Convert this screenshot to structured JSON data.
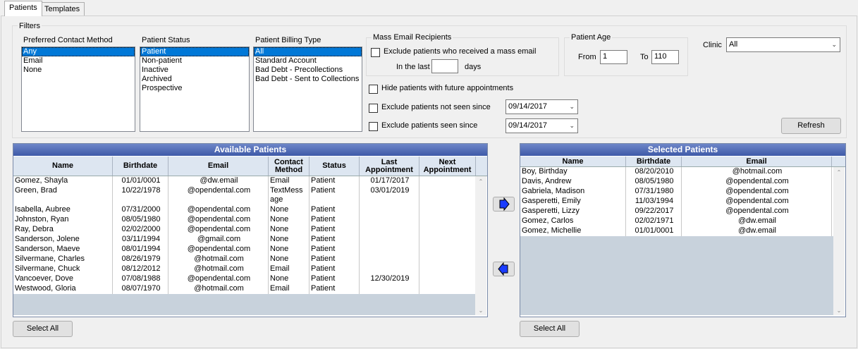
{
  "tabs": [
    {
      "label": "Patients"
    },
    {
      "label": "Templates"
    }
  ],
  "filters": {
    "group_label": "Filters",
    "preferred_contact": {
      "label": "Preferred Contact Method",
      "options": [
        "Any",
        "Email",
        "None"
      ],
      "selected": 0
    },
    "patient_status": {
      "label": "Patient Status",
      "options": [
        "Patient",
        "Non-patient",
        "Inactive",
        "Archived",
        "Prospective"
      ],
      "selected": 0
    },
    "billing_type": {
      "label": "Patient Billing Type",
      "options": [
        "All",
        "Standard Account",
        "Bad Debt - Precollections",
        "Bad Debt - Sent to Collections"
      ],
      "selected": 0
    },
    "mass_email": {
      "group_label": "Mass Email Recipients",
      "exclude_label": "Exclude patients who received a mass email",
      "in_last_label": "In the last",
      "in_last_value": "",
      "days_label": "days"
    },
    "hide_future_label": "Hide patients with future appointments",
    "exclude_not_seen": {
      "label": "Exclude patients not seen since",
      "date": "09/14/2017"
    },
    "exclude_seen": {
      "label": "Exclude patients seen since",
      "date": "09/14/2017"
    },
    "age": {
      "group_label": "Patient Age",
      "from_label": "From",
      "from_value": "1",
      "to_label": "To",
      "to_value": "110"
    },
    "clinic": {
      "label": "Clinic",
      "value": "All"
    },
    "refresh_label": "Refresh"
  },
  "available": {
    "title": "Available Patients",
    "headers": [
      "Name",
      "Birthdate",
      "Email",
      "Contact Method",
      "Status",
      "Last Appointment",
      "Next Appointment"
    ],
    "rows": [
      {
        "name": "Gomez, Shayla",
        "birth": "01/01/0001",
        "email": "@dw.email",
        "contact": "Email",
        "status": "Patient",
        "last": "01/17/2017",
        "next": ""
      },
      {
        "name": "Green, Brad",
        "birth": "10/22/1978",
        "email": "@opendental.com",
        "contact": "TextMess age",
        "status": "Patient",
        "last": "03/01/2019",
        "next": ""
      },
      {
        "name": "Isabella, Aubree",
        "birth": "07/31/2000",
        "email": "@opendental.com",
        "contact": "None",
        "status": "Patient",
        "last": "",
        "next": ""
      },
      {
        "name": "Johnston, Ryan",
        "birth": "08/05/1980",
        "email": "@opendental.com",
        "contact": "None",
        "status": "Patient",
        "last": "",
        "next": ""
      },
      {
        "name": "Ray, Debra",
        "birth": "02/02/2000",
        "email": "@opendental.com",
        "contact": "None",
        "status": "Patient",
        "last": "",
        "next": ""
      },
      {
        "name": "Sanderson, Jolene",
        "birth": "03/11/1994",
        "email": "@gmail.com",
        "contact": "None",
        "status": "Patient",
        "last": "",
        "next": ""
      },
      {
        "name": "Sanderson, Maeve",
        "birth": "08/01/1994",
        "email": "@opendental.com",
        "contact": "None",
        "status": "Patient",
        "last": "",
        "next": ""
      },
      {
        "name": "Silvermane, Charles",
        "birth": "08/26/1979",
        "email": "@hotmail.com",
        "contact": "None",
        "status": "Patient",
        "last": "",
        "next": ""
      },
      {
        "name": "Silvermane, Chuck",
        "birth": "08/12/2012",
        "email": "@hotmail.com",
        "contact": "Email",
        "status": "Patient",
        "last": "",
        "next": ""
      },
      {
        "name": "Vancoever, Dove",
        "birth": "07/08/1988",
        "email": "@opendental.com",
        "contact": "None",
        "status": "Patient",
        "last": "12/30/2019",
        "next": ""
      },
      {
        "name": "Westwood, Gloria",
        "birth": "08/07/1970",
        "email": "@hotmail.com",
        "contact": "Email",
        "status": "Patient",
        "last": "",
        "next": ""
      }
    ],
    "select_all_label": "Select All"
  },
  "selected": {
    "title": "Selected Patients",
    "headers": [
      "Name",
      "Birthdate",
      "Email"
    ],
    "rows": [
      {
        "name": "Boy, Birthday",
        "birth": "08/20/2010",
        "email": "@hotmail.com"
      },
      {
        "name": "Davis, Andrew",
        "birth": "08/05/1980",
        "email": "@opendental.com"
      },
      {
        "name": "Gabriela, Madison",
        "birth": "07/31/1980",
        "email": "@opendental.com"
      },
      {
        "name": "Gasperetti, Emily",
        "birth": "11/03/1994",
        "email": "@opendental.com"
      },
      {
        "name": "Gasperetti, Lizzy",
        "birth": "09/22/2017",
        "email": "@opendental.com"
      },
      {
        "name": "Gomez, Carlos",
        "birth": "02/02/1971",
        "email": "@dw.email"
      },
      {
        "name": "Gomez, Michellie",
        "birth": "01/01/0001",
        "email": "@dw.email"
      }
    ],
    "select_all_label": "Select All"
  },
  "colors": {
    "accent": "#0078d7",
    "grid_title": "#4a64b0",
    "move_arrow": "#1a3cff"
  },
  "icons": {
    "move_right": "arrow-right-icon",
    "move_left": "arrow-left-icon"
  }
}
